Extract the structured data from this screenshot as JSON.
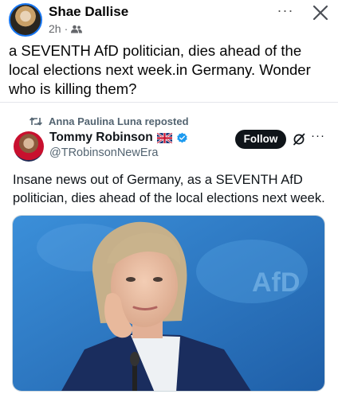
{
  "post": {
    "author": "Shae Dallise",
    "time": "2h",
    "separator": "·",
    "more_label": "···",
    "text": "a SEVENTH AfD politician, dies ahead of the local elections next week.in Germany. Wonder who is killing them?"
  },
  "embed": {
    "repost_label": "Anna Paulina Luna reposted",
    "name": "Tommy Robinson",
    "handle": "@TRobinsonNewEra",
    "follow_label": "Follow",
    "more_label": "···",
    "text": "Insane news out of Germany, as a SEVENTH AfD politician, dies ahead of the local elections next week.",
    "media_watermark": "AfD"
  },
  "colors": {
    "facebook_blue": "#1877f2",
    "verified_blue": "#1d9bf0",
    "media_background": "#2d7fcf"
  },
  "icons": [
    "friends-icon",
    "close-icon",
    "repost-icon",
    "uk-flag-icon",
    "verified-icon",
    "grok-icon"
  ]
}
